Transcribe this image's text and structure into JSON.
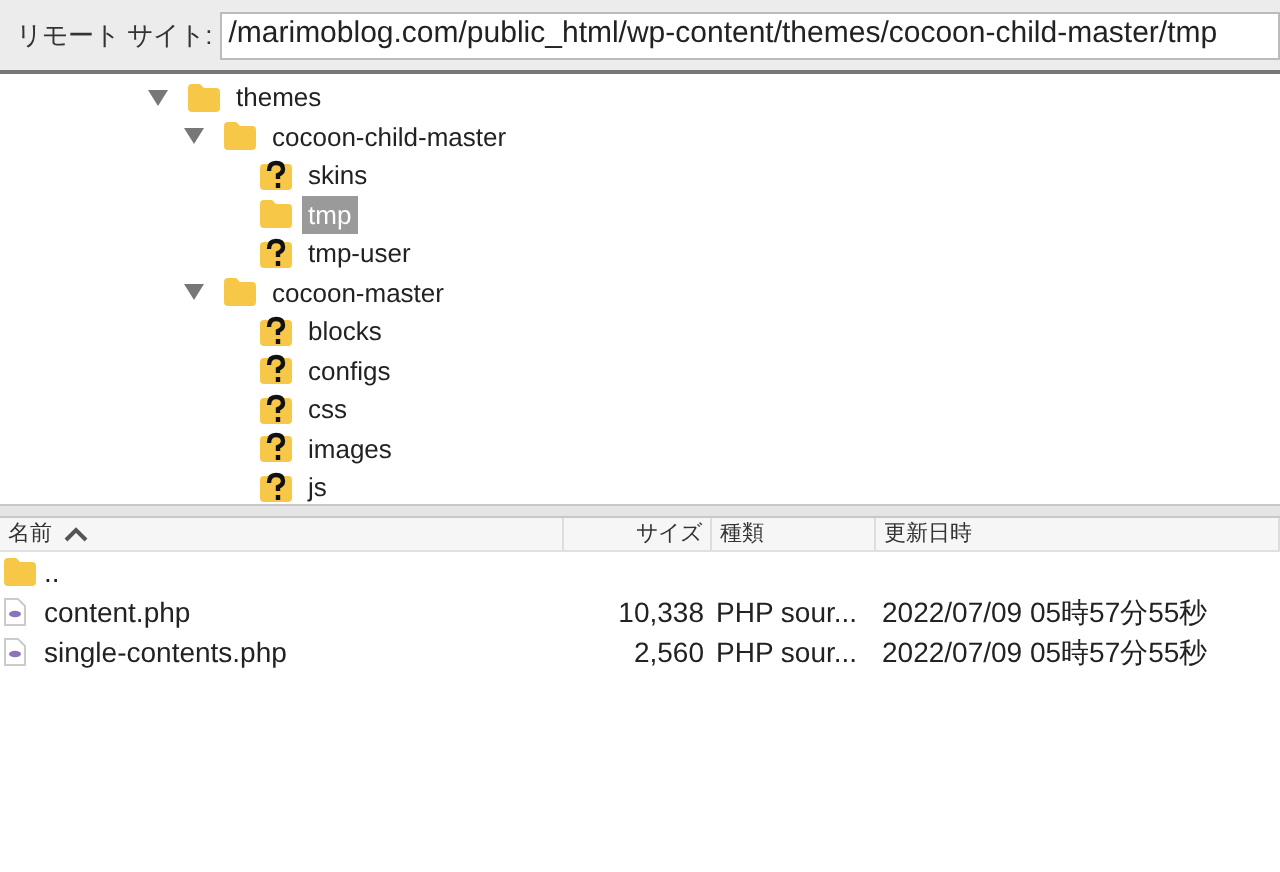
{
  "remote_site": {
    "label": "リモート サイト:",
    "path": "/marimoblog.com/public_html/wp-content/themes/cocoon-child-master/tmp"
  },
  "tree": [
    {
      "name": "themes",
      "kind": "folder",
      "expanded": true,
      "selected": false,
      "children": [
        {
          "name": "cocoon-child-master",
          "kind": "folder",
          "expanded": true,
          "selected": false,
          "children": [
            {
              "name": "skins",
              "kind": "unknown",
              "selected": false
            },
            {
              "name": "tmp",
              "kind": "folder",
              "selected": true
            },
            {
              "name": "tmp-user",
              "kind": "unknown",
              "selected": false
            }
          ]
        },
        {
          "name": "cocoon-master",
          "kind": "folder",
          "expanded": true,
          "selected": false,
          "children": [
            {
              "name": "blocks",
              "kind": "unknown",
              "selected": false
            },
            {
              "name": "configs",
              "kind": "unknown",
              "selected": false
            },
            {
              "name": "css",
              "kind": "unknown",
              "selected": false
            },
            {
              "name": "images",
              "kind": "unknown",
              "selected": false
            },
            {
              "name": "js",
              "kind": "unknown",
              "selected": false
            }
          ]
        }
      ]
    }
  ],
  "file_list": {
    "columns": [
      {
        "label": "名前",
        "sorted": true
      },
      {
        "label": "サイズ"
      },
      {
        "label": "種類"
      },
      {
        "label": "更新日時"
      }
    ],
    "rows": [
      {
        "kind": "folder",
        "name": ".."
      },
      {
        "kind": "php",
        "name": "content.php",
        "size": "10,338",
        "type": "PHP sour...",
        "modified": "2022/07/09 05時57分55秒"
      },
      {
        "kind": "php",
        "name": "single-contents.php",
        "size": "2,560",
        "type": "PHP sour...",
        "modified": "2022/07/09 05時57分55秒"
      }
    ]
  }
}
